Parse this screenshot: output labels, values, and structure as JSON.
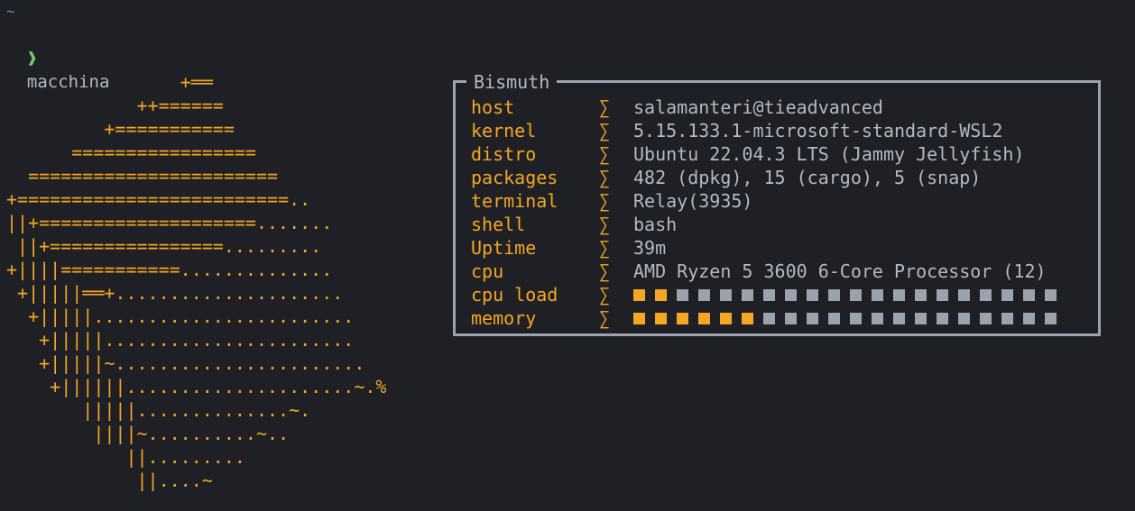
{
  "terminal": {
    "cwd": "~",
    "prompt_symbol": "❱",
    "command": "macchina"
  },
  "ascii_art": "                +══\n            ++======\n         +===========\n      =================\n  =======================\n+=========================..\n||+====================.......\n ||+================.........\n+||||===========..............\n +|||||══+.....................\n  +|||||........................\n   +|||||.......................\n   +|||||~.......................\n    +||||||.....................~.%\n       |||||..............~.\n        ||||~..........~..\n           ||.........\n            ||....~",
  "box": {
    "title": "Bismuth",
    "separator": "∑",
    "rows": [
      {
        "key": "host",
        "value": "salamanteri@tieadvanced"
      },
      {
        "key": "kernel",
        "value": "5.15.133.1-microsoft-standard-WSL2"
      },
      {
        "key": "distro",
        "value": "Ubuntu 22.04.3 LTS (Jammy Jellyfish)"
      },
      {
        "key": "packages",
        "value": "482 (dpkg), 15 (cargo), 5 (snap)"
      },
      {
        "key": "terminal",
        "value": "Relay(3935)"
      },
      {
        "key": "shell",
        "value": "bash"
      },
      {
        "key": "Uptime",
        "value": "39m"
      },
      {
        "key": "cpu",
        "value": "AMD Ryzen 5 3600 6-Core Processor (12)"
      }
    ],
    "bars": [
      {
        "key": "cpu load",
        "filled": 2,
        "total": 20
      },
      {
        "key": "memory",
        "filled": 6,
        "total": 20
      }
    ]
  },
  "colors": {
    "background": "#1e2025",
    "accent": "#f5a623",
    "text": "#b3b9c3",
    "prompt": "#6fd16b",
    "cwd": "#5e8fb2",
    "border": "#9ca3ae"
  }
}
